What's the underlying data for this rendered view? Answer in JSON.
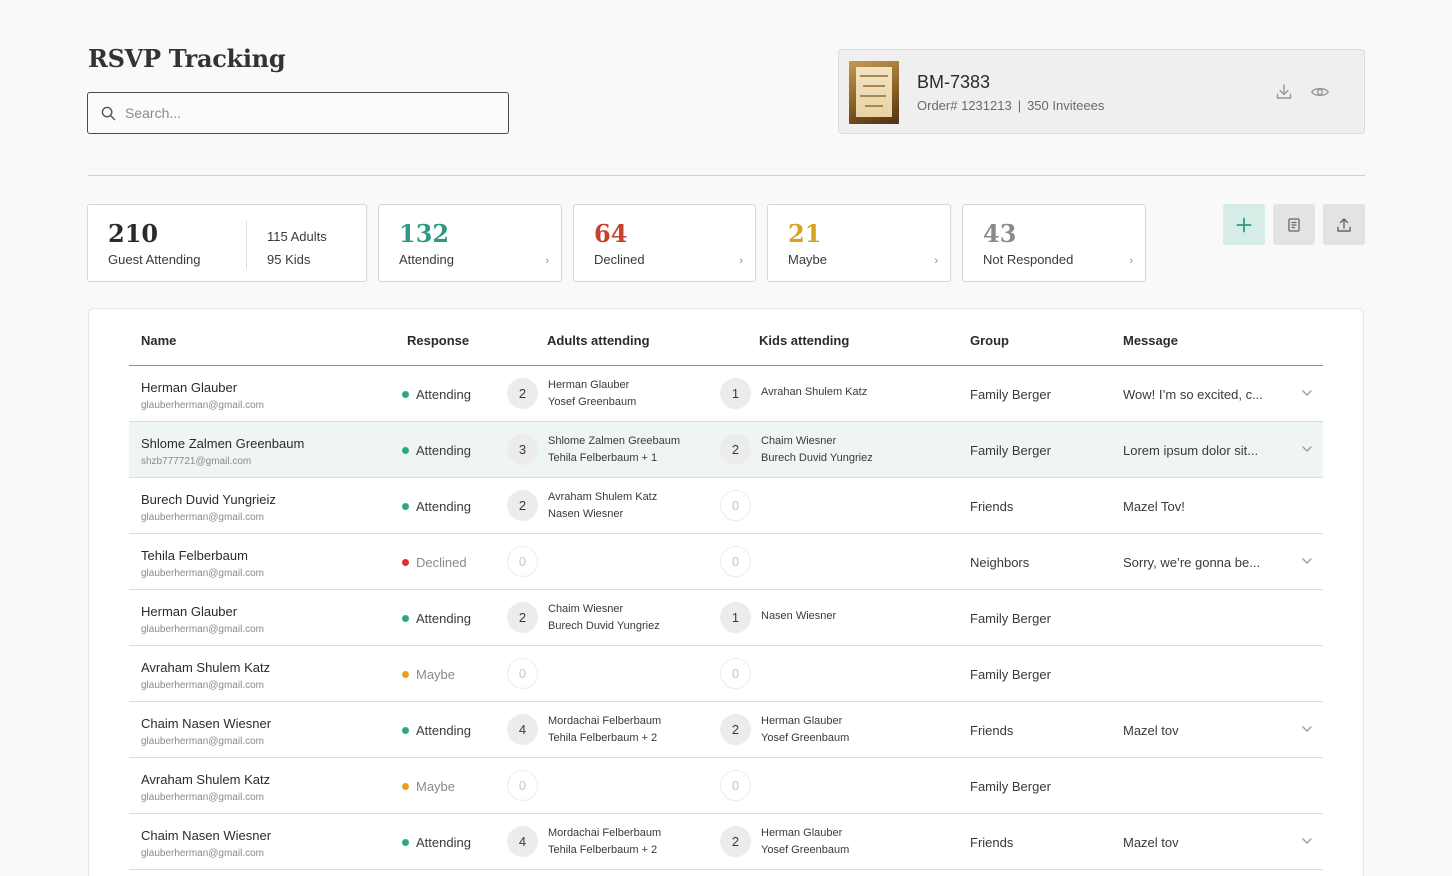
{
  "page": {
    "title": "RSVP Tracking"
  },
  "search": {
    "placeholder": "Search..."
  },
  "order": {
    "code": "BM-7383",
    "order_number": "Order# 1231213",
    "separator": "|",
    "invitees": "350 Inviteees"
  },
  "stats": {
    "guests": {
      "value": "210",
      "label": "Guest Attending",
      "adults": "115 Adults",
      "kids": "95 Kids"
    },
    "attending": {
      "value": "132",
      "label": "Attending",
      "color": "#2e9a82"
    },
    "declined": {
      "value": "64",
      "label": "Declined",
      "color": "#c8402c"
    },
    "maybe": {
      "value": "21",
      "label": "Maybe",
      "color": "#d8a21f"
    },
    "not_responded": {
      "value": "43",
      "label": "Not Responded",
      "color": "#8a8a8a"
    }
  },
  "colors": {
    "attending": "#2ba88a",
    "declined": "#e0302a",
    "maybe": "#e6a11d",
    "accent": "#2e9a82"
  },
  "table": {
    "columns": [
      "Name",
      "Response",
      "Adults attending",
      "Kids attending",
      "Group",
      "Message"
    ],
    "rows": [
      {
        "name": "Herman Glauber",
        "email": "glauberherman@gmail.com",
        "response": "Attending",
        "status": "attending",
        "adults_count": "2",
        "adults_names": [
          "Herman Glauber",
          "Yosef Greenbaum"
        ],
        "kids_count": "1",
        "kids_names": [
          "Avrahan Shulem Katz"
        ],
        "group": "Family Berger",
        "message": "Wow! I’m so excited, c...",
        "has_expand": true
      },
      {
        "name": "Shlome Zalmen Greenbaum",
        "email": "shzb777721@gmail.com",
        "response": "Attending",
        "status": "attending",
        "adults_count": "3",
        "adults_names": [
          "Shlome Zalmen Greebaum",
          "Tehila Felberbaum + 1"
        ],
        "kids_count": "2",
        "kids_names": [
          "Chaim Wiesner",
          "Burech Duvid Yungriez"
        ],
        "group": "Family Berger",
        "message": "Lorem ipsum dolor sit...",
        "has_expand": true,
        "highlight": true
      },
      {
        "name": "Burech Duvid Yungrieiz",
        "email": "glauberherman@gmail.com",
        "response": "Attending",
        "status": "attending",
        "adults_count": "2",
        "adults_names": [
          "Avraham Shulem Katz",
          "Nasen Wiesner"
        ],
        "kids_count": "0",
        "kids_names": [],
        "group": "Friends",
        "message": "Mazel Tov!",
        "has_expand": false
      },
      {
        "name": "Tehila Felberbaum",
        "email": "glauberherman@gmail.com",
        "response": "Declined",
        "status": "declined",
        "adults_count": "0",
        "adults_names": [],
        "kids_count": "0",
        "kids_names": [],
        "group": "Neighbors",
        "message": "Sorry, we’re gonna be...",
        "has_expand": true
      },
      {
        "name": "Herman Glauber",
        "email": "glauberherman@gmail.com",
        "response": "Attending",
        "status": "attending",
        "adults_count": "2",
        "adults_names": [
          "Chaim Wiesner",
          "Burech Duvid Yungriez"
        ],
        "kids_count": "1",
        "kids_names": [
          "Nasen Wiesner"
        ],
        "group": "Family Berger",
        "message": "",
        "has_expand": false
      },
      {
        "name": "Avraham Shulem Katz",
        "email": "glauberherman@gmail.com",
        "response": "Maybe",
        "status": "maybe",
        "adults_count": "0",
        "adults_names": [],
        "kids_count": "0",
        "kids_names": [],
        "group": "Family Berger",
        "message": "",
        "has_expand": false
      },
      {
        "name": "Chaim Nasen Wiesner",
        "email": "glauberherman@gmail.com",
        "response": "Attending",
        "status": "attending",
        "adults_count": "4",
        "adults_names": [
          "Mordachai Felberbaum",
          "Tehila Felberbaum + 2"
        ],
        "kids_count": "2",
        "kids_names": [
          "Herman Glauber",
          "Yosef Greenbaum"
        ],
        "group": "Friends",
        "message": "Mazel tov",
        "has_expand": true
      },
      {
        "name": "Avraham Shulem Katz",
        "email": "glauberherman@gmail.com",
        "response": "Maybe",
        "status": "maybe",
        "adults_count": "0",
        "adults_names": [],
        "kids_count": "0",
        "kids_names": [],
        "group": "Family Berger",
        "message": "",
        "has_expand": false
      },
      {
        "name": "Chaim Nasen Wiesner",
        "email": "glauberherman@gmail.com",
        "response": "Attending",
        "status": "attending",
        "adults_count": "4",
        "adults_names": [
          "Mordachai Felberbaum",
          "Tehila Felberbaum + 2"
        ],
        "kids_count": "2",
        "kids_names": [
          "Herman Glauber",
          "Yosef Greenbaum"
        ],
        "group": "Friends",
        "message": "Mazel tov",
        "has_expand": true
      }
    ]
  }
}
